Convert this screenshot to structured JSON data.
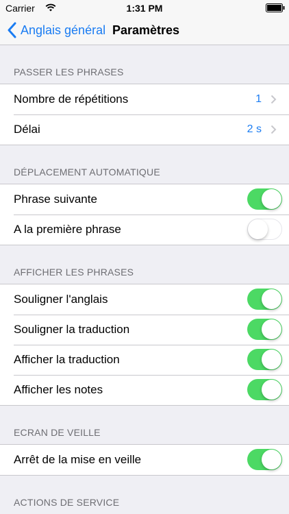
{
  "status_bar": {
    "carrier": "Carrier",
    "time": "1:31 PM"
  },
  "nav": {
    "back_label": "Anglais général",
    "title": "Paramètres"
  },
  "sections": {
    "passer": {
      "header": "PASSER LES PHRASES",
      "repetitions": {
        "label": "Nombre de répétitions",
        "value": "1"
      },
      "delai": {
        "label": "Délai",
        "value": "2 s"
      }
    },
    "deplacement": {
      "header": "DÉPLACEMENT AUTOMATIQUE",
      "phrase_suivante": {
        "label": "Phrase suivante",
        "on": true
      },
      "premiere_phrase": {
        "label": "A la première phrase",
        "on": false
      }
    },
    "afficher": {
      "header": "AFFICHER LES PHRASES",
      "souligner_anglais": {
        "label": "Souligner l'anglais",
        "on": true
      },
      "souligner_traduction": {
        "label": "Souligner la traduction",
        "on": true
      },
      "afficher_traduction": {
        "label": "Afficher la traduction",
        "on": true
      },
      "afficher_notes": {
        "label": "Afficher les notes",
        "on": true
      }
    },
    "veille": {
      "header": "ECRAN DE VEILLE",
      "arret_veille": {
        "label": "Arrêt de la mise en veille",
        "on": true
      }
    },
    "actions": {
      "header": "ACTIONS DE SERVICE"
    }
  },
  "colors": {
    "accent": "#1a7cf2",
    "toggle_on": "#4cd964",
    "background": "#efeff4"
  }
}
